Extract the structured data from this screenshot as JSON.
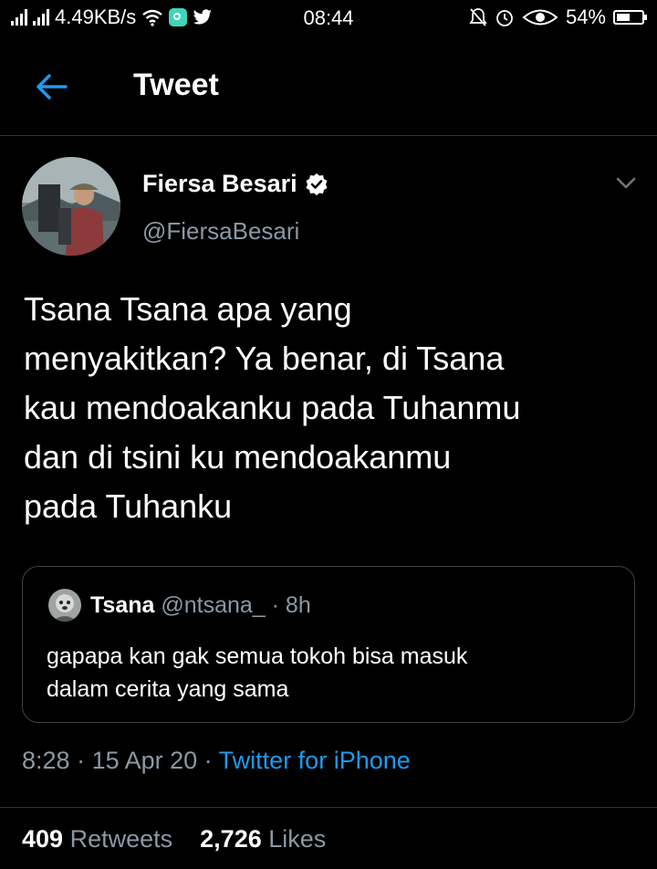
{
  "status_bar": {
    "network_speed": "4.49KB/s",
    "time": "08:44",
    "battery": "54%",
    "battery_level": 0.54,
    "icons": [
      "signal-icon",
      "signal-icon",
      "wifi-icon",
      "app-notification-icon",
      "twitter-icon",
      "mute-bell-icon",
      "alarm-icon",
      "eye-icon",
      "battery-icon"
    ]
  },
  "header": {
    "title": "Tweet",
    "back_icon": "arrow-left-icon"
  },
  "author": {
    "name": "Fiersa Besari",
    "handle": "@FiersaBesari",
    "verified": true
  },
  "tweet": {
    "text": "Tsana Tsana apa yang\nmenyakitkan? Ya benar, di Tsana\nkau mendoakanku pada Tuhanmu\ndan di tsini ku mendoakanmu\npada Tuhanku"
  },
  "quote": {
    "name": "Tsana",
    "handle": "@ntsana_",
    "sep": " · ",
    "age": "8h",
    "text": "gapapa kan gak semua tokoh bisa masuk\ndalam cerita yang sama"
  },
  "meta": {
    "time": "8:28",
    "sep1": " · ",
    "date": "15 Apr 20",
    "sep2": " · ",
    "source": "Twitter for iPhone"
  },
  "stats": {
    "retweets_count": "409",
    "retweets_label": "Retweets",
    "likes_count": "2,726",
    "likes_label": "Likes"
  },
  "colors": {
    "accent": "#1d9bf0",
    "secondary_text": "#8b98a5",
    "background": "#000000"
  }
}
